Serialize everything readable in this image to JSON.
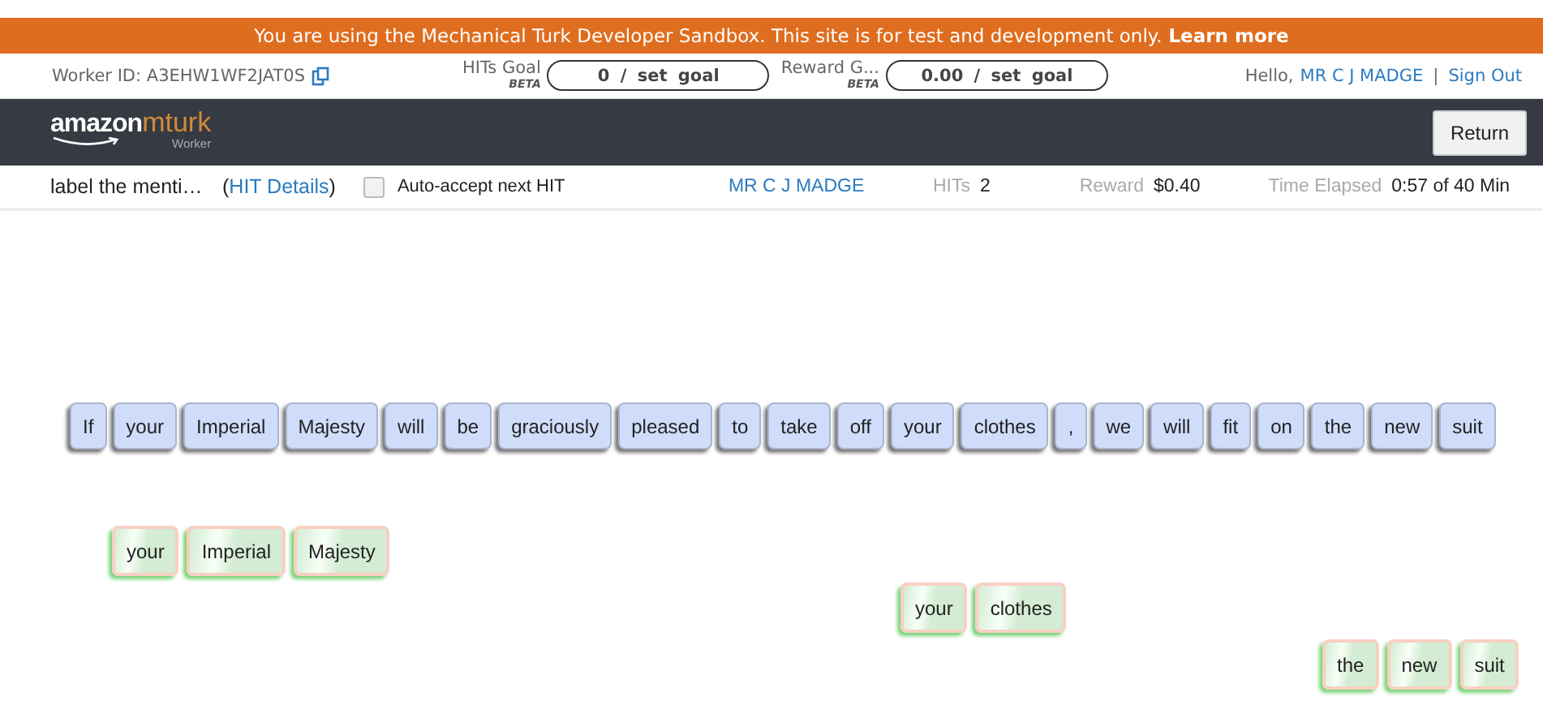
{
  "banner": {
    "text": "You are using the Mechanical Turk Developer Sandbox. This site is for test and development only.",
    "link": "Learn more"
  },
  "info_bar": {
    "worker_id": "Worker ID: A3EHW1WF2JAT0S",
    "hits_goal": {
      "label": "HITs Goal",
      "badge": "BETA",
      "value": "0 / set goal"
    },
    "reward_goal": {
      "label": "Reward G...",
      "badge": "BETA",
      "value": "0.00 / set goal"
    },
    "greeting": "Hello,",
    "user": "MR C J MADGE",
    "separator": "|",
    "sign_out": "Sign Out"
  },
  "header": {
    "logo_main": "amazon",
    "logo_accent": "mturk",
    "logo_sub": "Worker",
    "return_button": "Return"
  },
  "hit_bar": {
    "title": "label the menti…",
    "open_paren": "(",
    "details_link": "HIT Details",
    "close_paren": ")",
    "auto_accept": {
      "label": "Auto-accept next HIT",
      "checked": false
    },
    "requester": "MR C J MADGE",
    "hits_label": "HITs",
    "hits_value": "2",
    "reward_label": "Reward",
    "reward_value": "$0.40",
    "time_label": "Time Elapsed",
    "time_value": "0:57 of 40 Min"
  },
  "tokens": [
    "If",
    "your",
    "Imperial",
    "Majesty",
    "will",
    "be",
    "graciously",
    "pleased",
    "to",
    "take",
    "off",
    "your",
    "clothes",
    ",",
    "we",
    "will",
    "fit",
    "on",
    "the",
    "new",
    "suit"
  ],
  "mentions": [
    {
      "words": [
        "your",
        "Imperial",
        "Majesty"
      ]
    },
    {
      "words": [
        "your",
        "clothes"
      ]
    },
    {
      "words": [
        "the",
        "new",
        "suit"
      ]
    }
  ]
}
